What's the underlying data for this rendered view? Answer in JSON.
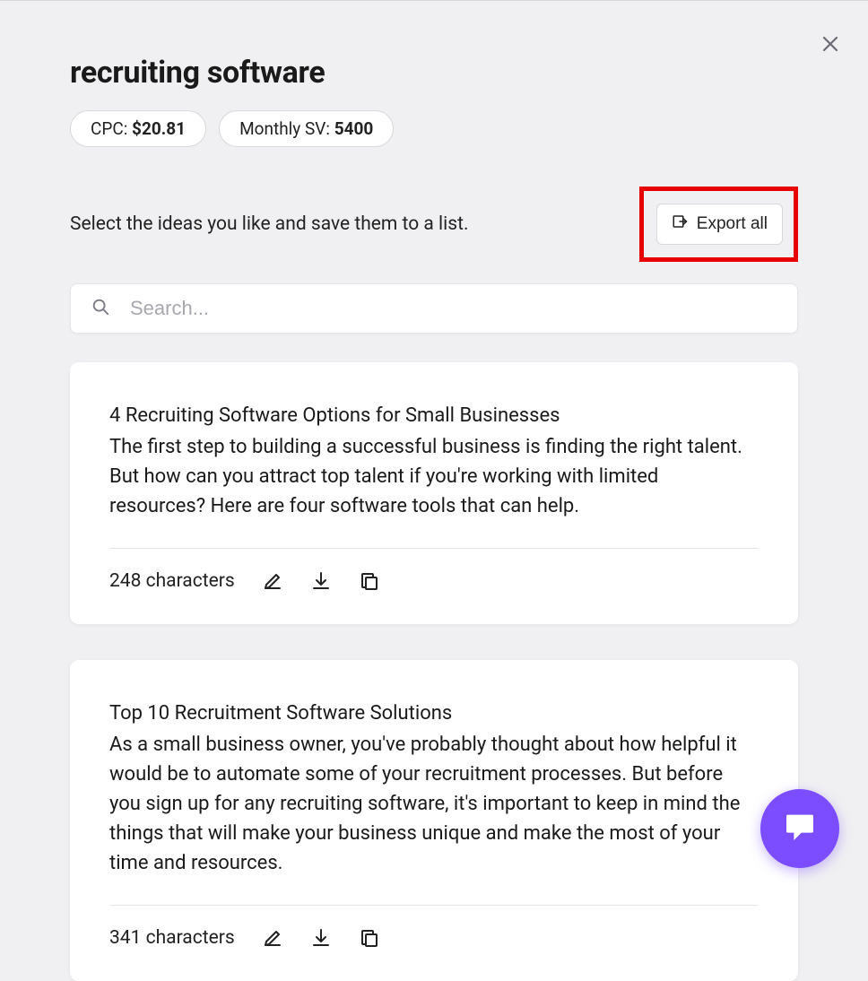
{
  "title": "recruiting software",
  "metrics": {
    "cpc": {
      "label": "CPC: ",
      "value": "$20.81"
    },
    "sv": {
      "label": "Monthly SV: ",
      "value": "5400"
    }
  },
  "subhead": "Select the ideas you like and save them to a list.",
  "export_label": "Export all",
  "search": {
    "placeholder": "Search..."
  },
  "cards": [
    {
      "title": "4 Recruiting Software Options for Small Businesses",
      "desc": "The first step to building a successful business is finding the right talent. But how can you attract top talent if you're working with limited resources? Here are four software tools that can help.",
      "char_count": "248 characters"
    },
    {
      "title": "Top 10 Recruitment Software Solutions",
      "desc": "As a small business owner, you've probably thought about how helpful it would be to automate some of your recruitment processes. But before you sign up for any recruiting software, it's important to keep in mind the things that will make your business unique and make the most of your time and resources.",
      "char_count": "341 characters"
    }
  ]
}
